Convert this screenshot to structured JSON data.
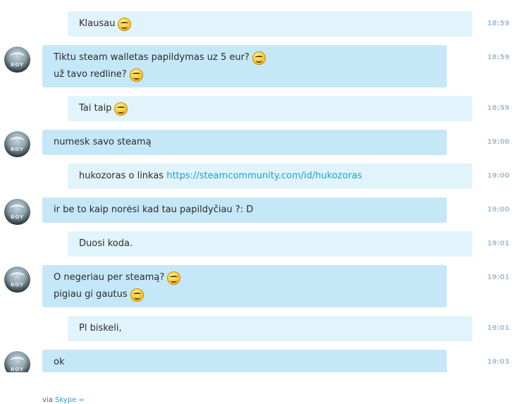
{
  "messages": [
    {
      "direction": "out",
      "lines": [
        {
          "text": "Klausau",
          "emoji": true
        }
      ],
      "time": "18:59"
    },
    {
      "direction": "in",
      "lines": [
        {
          "text": "Tiktu steam walletas papildymas uz 5 eur?",
          "emoji": true
        },
        {
          "text": "už tavo redline?",
          "emoji": true
        }
      ],
      "time": "18:59"
    },
    {
      "direction": "out",
      "lines": [
        {
          "text": "Tai taip",
          "emoji": true
        }
      ],
      "time": "18:59"
    },
    {
      "direction": "in",
      "lines": [
        {
          "text": "numesk savo steamą",
          "emoji": false
        }
      ],
      "time": "19:00"
    },
    {
      "direction": "out",
      "lines": [
        {
          "text": "hukozoras o linkas ",
          "link": "https://steamcommunity.com/id/hukozoras",
          "emoji": false
        }
      ],
      "time": "19:00"
    },
    {
      "direction": "in",
      "lines": [
        {
          "text": "ir be to kaip norėsi kad tau papildyčiau ?: D",
          "emoji": false
        }
      ],
      "time": "19:00"
    },
    {
      "direction": "out",
      "lines": [
        {
          "text": "Duosi koda.",
          "emoji": false
        }
      ],
      "time": "19:01"
    },
    {
      "direction": "in",
      "lines": [
        {
          "text": "O negeriau per steamą?",
          "emoji": true
        },
        {
          "text": "pigiau gi gautus",
          "emoji": true
        }
      ],
      "time": "19:01"
    },
    {
      "direction": "out",
      "lines": [
        {
          "text": "Pl biskeli,",
          "emoji": false
        }
      ],
      "time": "19:01"
    },
    {
      "direction": "in",
      "lines": [
        {
          "text": "ok",
          "emoji": false
        }
      ],
      "time": "19:03"
    }
  ],
  "avatar": {
    "label": "BOY",
    "icon": "avatar-eagle-icon"
  },
  "emoji_icon": "smile-emoticon-icon",
  "footer": {
    "via": "via ",
    "skype": "Skype ="
  },
  "colors": {
    "incoming_bubble": "#c5e8f8",
    "outgoing_bubble": "#e1f3fb",
    "timestamp": "#a9bfcf",
    "link": "#1f9fd0"
  }
}
